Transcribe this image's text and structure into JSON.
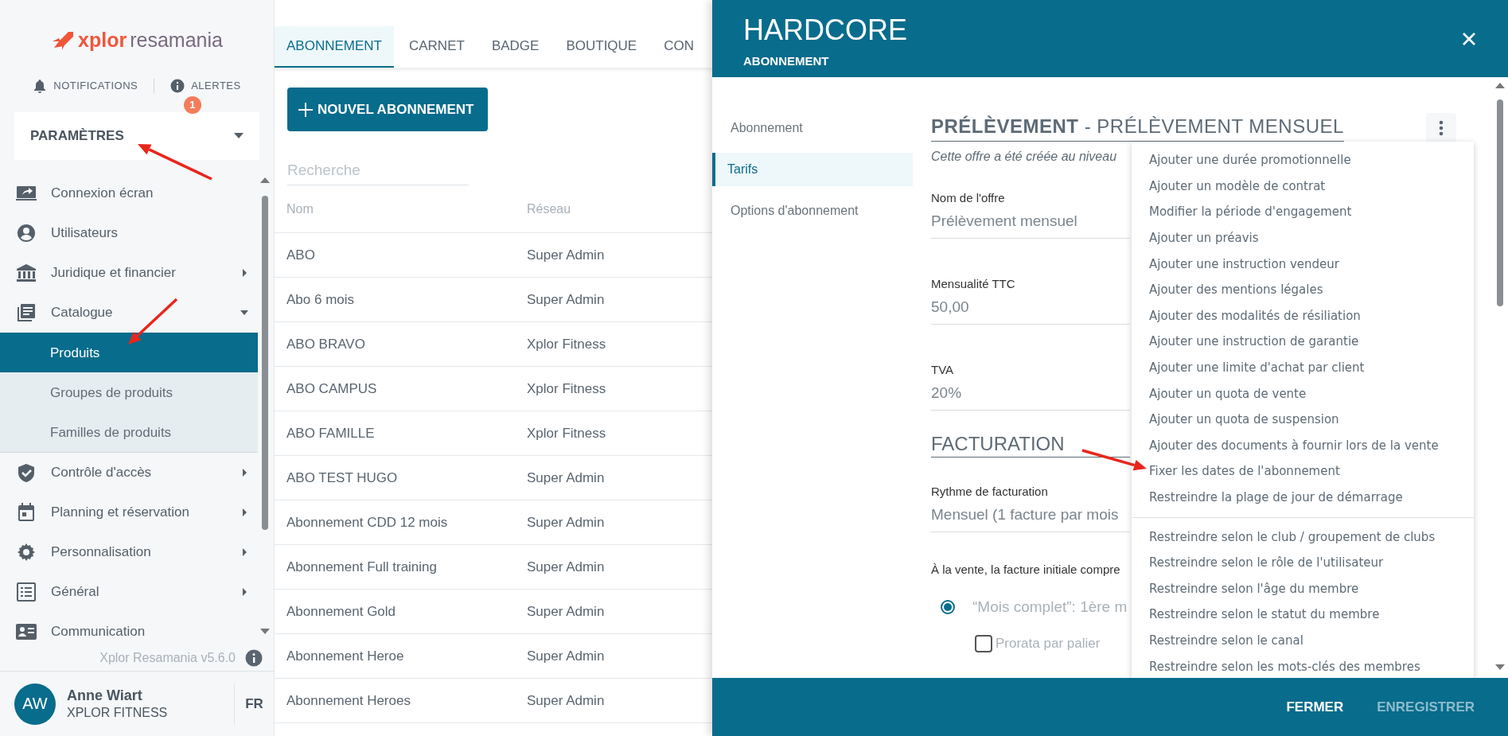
{
  "logo": {
    "brand": "xplor",
    "product": "resamania"
  },
  "top_links": [
    {
      "label": "NOTIFICATIONS"
    },
    {
      "label": "ALERTES",
      "badge": "1"
    }
  ],
  "section_select": {
    "value": "PARAMÈTRES"
  },
  "sidebar": {
    "items": [
      {
        "label": "Connexion écran",
        "expandable": false
      },
      {
        "label": "Utilisateurs",
        "expandable": false
      },
      {
        "label": "Juridique et financier",
        "expandable": true,
        "expanded": false
      },
      {
        "label": "Catalogue",
        "expandable": true,
        "expanded": true,
        "children": [
          {
            "label": "Produits",
            "selected": true
          },
          {
            "label": "Groupes de produits",
            "selected": false
          },
          {
            "label": "Familles de produits",
            "selected": false
          }
        ]
      },
      {
        "label": "Contrôle d'accès",
        "expandable": true,
        "expanded": false
      },
      {
        "label": "Planning et réservation",
        "expandable": true,
        "expanded": false
      },
      {
        "label": "Personnalisation",
        "expandable": true,
        "expanded": false
      },
      {
        "label": "Général",
        "expandable": true,
        "expanded": false
      },
      {
        "label": "Communication",
        "expandable": false
      }
    ]
  },
  "version": "Xplor Resamania v5.6.0",
  "user": {
    "initials": "AW",
    "name": "Anne Wiart",
    "org": "XPLOR FITNESS",
    "language": "FR"
  },
  "tabs": [
    {
      "label": "ABONNEMENT",
      "selected": true
    },
    {
      "label": "CARNET",
      "selected": false
    },
    {
      "label": "BADGE",
      "selected": false
    },
    {
      "label": "BOUTIQUE",
      "selected": false
    },
    {
      "label": "CON",
      "selected": false
    }
  ],
  "new_button": "NOUVEL ABONNEMENT",
  "search": {
    "placeholder": "Recherche"
  },
  "table": {
    "columns": [
      "Nom",
      "Réseau"
    ],
    "rows": [
      [
        "ABO",
        "Super Admin"
      ],
      [
        "Abo 6 mois",
        "Super Admin"
      ],
      [
        "ABO BRAVO",
        "Xplor Fitness"
      ],
      [
        "ABO CAMPUS",
        "Xplor Fitness"
      ],
      [
        "ABO FAMILLE",
        "Xplor Fitness"
      ],
      [
        "ABO TEST HUGO",
        "Super Admin"
      ],
      [
        "Abonnement CDD 12 mois",
        "Super Admin"
      ],
      [
        "Abonnement Full training",
        "Super Admin"
      ],
      [
        "Abonnement Gold",
        "Super Admin"
      ],
      [
        "Abonnement Heroe",
        "Super Admin"
      ],
      [
        "Abonnement Heroes",
        "Super Admin"
      ]
    ]
  },
  "panel": {
    "title": "HARDCORE",
    "subtitle": "ABONNEMENT",
    "nav": [
      {
        "label": "Abonnement",
        "selected": false
      },
      {
        "label": "Tarifs",
        "selected": true
      },
      {
        "label": "Options d'abonnement",
        "selected": false
      }
    ],
    "heading": "**PRÉLÈVEMENT** - PRÉLÈVEMENT MENSUEL",
    "note": "Cette offre a été créée au niveau",
    "fields": [
      {
        "label": "Nom de l'offre",
        "value": "Prélèvement mensuel"
      },
      {
        "label": "Mensualité TTC",
        "value": "50,00"
      },
      {
        "label": "TVA",
        "value": "20%"
      }
    ],
    "billing": {
      "heading": "FACTURATION",
      "fields": [
        {
          "label": "Rythme de facturation",
          "value": "Mensuel (1 facture par mois"
        }
      ],
      "question": "À la vente, la facture initiale compre",
      "radio": {
        "label": "“Mois complet”: 1ère m",
        "selected": true
      },
      "checkbox": {
        "label": "Prorata par palier",
        "checked": false
      }
    },
    "menu": {
      "groups": [
        [
          "Ajouter une durée promotionnelle",
          "Ajouter un modèle de contrat",
          "Modifier la période d'engagement",
          "Ajouter un préavis",
          "Ajouter une instruction vendeur",
          "Ajouter des mentions légales",
          "Ajouter des modalités de résiliation",
          "Ajouter une instruction de garantie",
          "Ajouter une limite d'achat par client",
          "Ajouter un quota de vente",
          "Ajouter un quota de suspension",
          "Ajouter des documents à fournir lors de la vente",
          "Fixer les dates de l'abonnement",
          "Restreindre la plage de jour de démarrage"
        ],
        [
          "Restreindre selon le club / groupement de clubs",
          "Restreindre selon le rôle de l'utilisateur",
          "Restreindre selon l'âge du membre",
          "Restreindre selon le statut du membre",
          "Restreindre selon le canal",
          "Restreindre selon les mots-clés des membres"
        ]
      ]
    },
    "buttons": [
      {
        "label": "FERMER",
        "disabled": false
      },
      {
        "label": "ENREGISTRER",
        "disabled": true
      }
    ]
  }
}
